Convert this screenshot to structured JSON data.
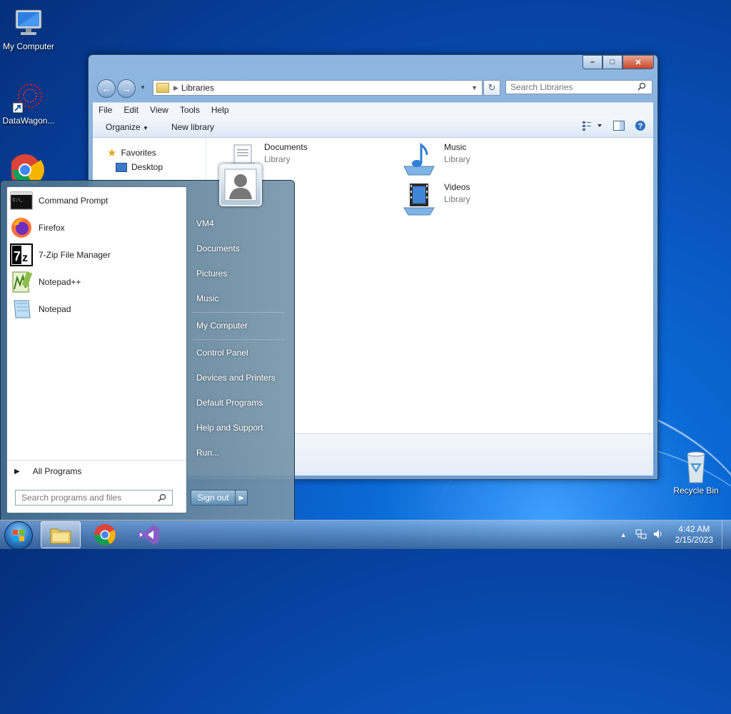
{
  "desktop": {
    "icons": [
      {
        "label": "My Computer",
        "icon": "monitor-icon"
      },
      {
        "label": "DataWagon...",
        "icon": "datawagon-icon"
      },
      {
        "label": "",
        "icon": "chrome-icon"
      },
      {
        "label": "Recycle Bin",
        "icon": "recycle-bin-icon"
      }
    ]
  },
  "explorer": {
    "address": "Libraries",
    "search_placeholder": "Search Libraries",
    "menu": [
      "File",
      "Edit",
      "View",
      "Tools",
      "Help"
    ],
    "commands": {
      "organize": "Organize",
      "new_library": "New library"
    },
    "nav": {
      "favorites": "Favorites",
      "desktop": "Desktop"
    },
    "libraries": [
      {
        "name": "Documents",
        "type": "Library",
        "icon": "documents-library-icon"
      },
      {
        "name": "Music",
        "type": "Library",
        "icon": "music-library-icon"
      },
      {
        "name": "Videos",
        "type": "Library",
        "icon": "videos-library-icon"
      }
    ],
    "window_buttons": {
      "minimize": "–",
      "maximize": "□",
      "close": "✕"
    }
  },
  "start_menu": {
    "programs": [
      {
        "label": "Command Prompt",
        "icon": "command-prompt-icon"
      },
      {
        "label": "Firefox",
        "icon": "firefox-icon"
      },
      {
        "label": "7-Zip File Manager",
        "icon": "7zip-icon"
      },
      {
        "label": "Notepad++",
        "icon": "notepadpp-icon"
      },
      {
        "label": "Notepad",
        "icon": "notepad-icon"
      }
    ],
    "all_programs": "All Programs",
    "search_placeholder": "Search programs and files",
    "right_items": [
      "VM4",
      "Documents",
      "Pictures",
      "Music",
      "My Computer",
      "Control Panel",
      "Devices and Printers",
      "Default Programs",
      "Help and Support",
      "Run..."
    ],
    "sign_out": "Sign out"
  },
  "taskbar": {
    "pinned": [
      "file-explorer-icon",
      "chrome-icon",
      "visual-studio-icon"
    ],
    "time": "4:42 AM",
    "date": "2/15/2023"
  }
}
